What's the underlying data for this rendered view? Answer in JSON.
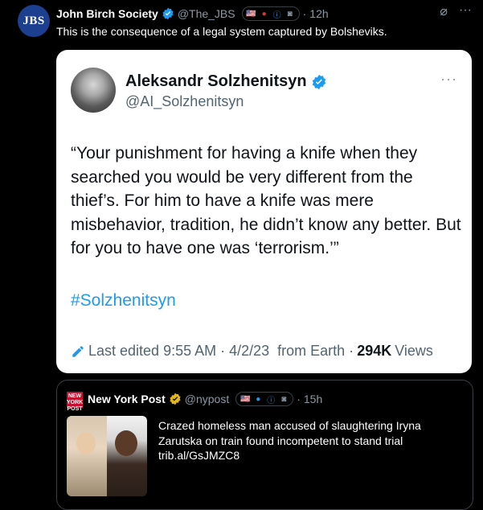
{
  "post": {
    "avatar_text": "JBS",
    "name": "John Birch Society",
    "handle": "@The_JBS",
    "time": "12h",
    "text": "This is the consequence of a legal system captured by Bolsheviks."
  },
  "embedded": {
    "name": "Aleksandr Solzhenitsyn",
    "handle": "@AI_Solzhenitsyn",
    "more": "···",
    "quote": "“Your punishment for having a knife when they searched you would be very different from the thief’s. For him to have a knife was mere misbehavior, tradition, he didn’t know any better. But for you to have one was ‘terrorism.’”",
    "hashtag": "#Solzhenitsyn",
    "edited": "Last edited 9:55 AM · 4/2/23",
    "source": "from Earth ·",
    "views_count": "294K",
    "views_label": "Views"
  },
  "quoted": {
    "logo_text": "NEW YORK POST",
    "name": "New York Post",
    "handle": "@nypost",
    "time": "15h",
    "text": "Crazed homeless man accused of slaughtering Iryna Zarutska on train found incompetent to stand trial",
    "link": "trib.al/GsJMZC8"
  },
  "colors": {
    "accent": "#1d9bf0",
    "verified": "#1d9bf0",
    "gold": "#e2b719"
  }
}
